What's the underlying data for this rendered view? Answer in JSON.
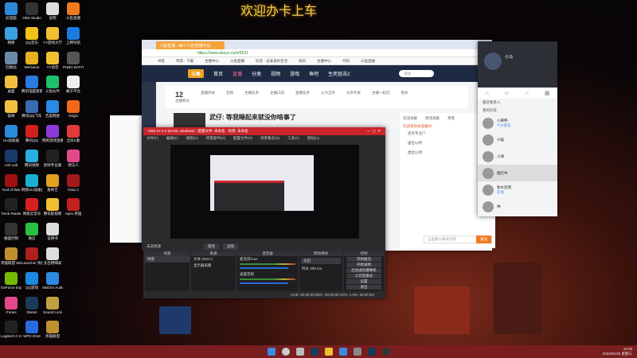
{
  "wallpaper_title": "欢迎办卡上车",
  "desktop_icons": [
    [
      "此电脑",
      "#2a8ad8"
    ],
    [
      "OBS Studio",
      "#333"
    ],
    [
      "说明",
      "#ddd"
    ],
    [
      "斗鱼直播",
      "#f07a20"
    ],
    [
      "网络",
      "#3aa0e0"
    ],
    [
      "QQ音乐",
      "#f2c21a"
    ],
    [
      "YY游戏大厅",
      "#f0c030"
    ],
    [
      "上网导航",
      "#1a7ae0"
    ],
    [
      "回收站",
      "#6a8aa8"
    ],
    [
      "WeGame",
      "#e8b020"
    ],
    [
      "YY语音",
      "#f0c030"
    ],
    [
      "PUBG BATTLEGR...",
      "#555"
    ],
    [
      "桌面",
      "#f0c040"
    ],
    [
      "腾讯电脑管家",
      "#2a7ae0"
    ],
    [
      "斗鱼伙伴",
      "#1ec06a"
    ],
    [
      "桶子平台",
      "#eee"
    ],
    [
      "猫咪",
      "#f0c040"
    ],
    [
      "腾讯QQ飞车",
      "#3a6ab0"
    ],
    [
      "百度网盘",
      "#2a8ae8"
    ],
    [
      "Origin",
      "#f06a1a"
    ],
    [
      "UU加速器",
      "#2a8ad8"
    ],
    [
      "腾讯QQ",
      "#d02020"
    ],
    [
      "网易游戏直播助手",
      "#8a3ad8"
    ],
    [
      "全民K歌",
      "#e03a3a"
    ],
    [
      "Aim Lab",
      "#1a3a6a"
    ],
    [
      "腾讯视频",
      "#2ab0e0"
    ],
    [
      "剪映专业版",
      "#222"
    ],
    [
      "喂马人",
      "#e04a8a"
    ],
    [
      "God of War",
      "#a01010"
    ],
    [
      "网易UU加速器",
      "#1ab0d0"
    ],
    [
      "爱奇艺",
      "#e0a020"
    ],
    [
      "Dota 2",
      "#a01a1a"
    ],
    [
      "Tomb Raider",
      "#222"
    ],
    [
      "网易云音乐",
      "#d82020"
    ],
    [
      "腾讯影视库",
      "#f0c030"
    ],
    [
      "Apex 英雄",
      "#c02020"
    ],
    [
      "顺盛控制",
      "#333"
    ],
    [
      "微信",
      "#2ac040"
    ],
    [
      "说明书",
      "#ddd"
    ],
    null,
    [
      "英雄联盟 WeGame版",
      "#c09030"
    ],
    [
      "Launcher 快捷方式",
      "#b02020"
    ],
    [
      "支出明细表",
      "#ddd"
    ],
    null,
    [
      "GeForce Experience",
      "#76b900"
    ],
    [
      "QQ游戏",
      "#1a8ae0"
    ],
    [
      "XBOXA Audio",
      "#2a8ae0"
    ],
    null,
    [
      "iTunes",
      "#e04a8a"
    ],
    [
      "Steam",
      "#1a3a5a"
    ],
    [
      "Sound Lock",
      "#c0a040"
    ],
    null,
    [
      "Logitech G HUB",
      "#222"
    ],
    [
      "WPS 2019",
      "#2a6ae0"
    ],
    [
      "英雄联盟",
      "#c09030"
    ],
    null
  ],
  "browser": {
    "tab": "斗鱼直播 - 每个人的直播平台",
    "url": "https://www.douyu.com/9621",
    "bookmarks": [
      "书签",
      "鸡肉 - 下载",
      "主播中心",
      "斗鱼直播",
      "抖音 - 记录美好生活",
      "快讯",
      "主播中心",
      "代码",
      "斗鱼直播"
    ],
    "nav": [
      "首页",
      "直播",
      "分类",
      "视频",
      "游戏",
      "鱼吧",
      "生死狙击2"
    ],
    "logo": "斗鱼",
    "search_placeholder": "搜索",
    "stats": [
      [
        "12",
        "主播积分"
      ],
      [
        "",
        "直播开关"
      ],
      [
        "",
        "音频"
      ],
      [
        "",
        "主播任务"
      ],
      [
        "",
        "主播口袋"
      ],
      [
        "",
        "直播任务"
      ],
      [
        "",
        "火力全开"
      ],
      [
        "",
        "分享开关"
      ],
      [
        "",
        "主播一起玩"
      ],
      [
        "",
        "更多"
      ]
    ],
    "stream_title": "武仔: 等我睡起来就没你啥事了",
    "panel_tabs": [
      "日流贡献",
      "周流贡献",
      "贵宾"
    ],
    "panel_notice": "欢迎来到本直播间",
    "panel_users": [
      "虎牙专业户",
      "虚位以待",
      "虚位以待"
    ],
    "chat_placeholder": "这里输入聊天内容",
    "send": "发送"
  },
  "obs": {
    "title": "OBS 27.2.2 (64-bit, windows) - 配置文件: 未命名 - 场景: 未命名",
    "menu": [
      "文件(F)",
      "编辑(E)",
      "视图(V)",
      "停靠部件(D)",
      "配置文件(P)",
      "场景集合(S)",
      "工具(T)",
      "帮助(H)"
    ],
    "no_source": "未选择源",
    "properties": "属性",
    "filters": "滤镜",
    "docks": {
      "scenes": "场景",
      "sources": "来源",
      "mixer": "混音器",
      "transitions": "转场特效",
      "controls": "控制"
    },
    "scene_items": [
      "场景"
    ],
    "source_items": [
      "文本 (GDI+)",
      "显示器采集"
    ],
    "mixer_items": [
      "麦克风/Aux",
      "桌面音频"
    ],
    "transition": "淡出",
    "duration_label": "时长",
    "duration": "300 ms",
    "controls": [
      "开始推流",
      "开始录制",
      "启动虚拟摄像机",
      "工作室模式",
      "设置",
      "退出"
    ],
    "status": "LIVE: 00:00:00   REC: 00:00:00   CPU: 1.0%, 60.00 fps"
  },
  "qq": {
    "name": "小马",
    "groups": [
      "最近联系人",
      "我的好友"
    ],
    "friends": [
      [
        "小黄鸭",
        "TTS签名"
      ],
      [
        "小猫",
        ""
      ],
      [
        "小海",
        ""
      ],
      [
        "摆烂中",
        ""
      ],
      [
        "秋水涟漪",
        "在线"
      ],
      [
        "林",
        ""
      ]
    ]
  },
  "taskbar": {
    "time": "10:08",
    "date": "2022/01/26 星期三"
  }
}
